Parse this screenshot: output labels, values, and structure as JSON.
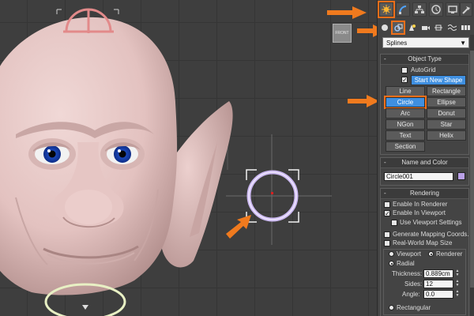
{
  "viewport": {
    "cube_label": "FRONT"
  },
  "panel": {
    "create_tabs": [
      "Create",
      "Modify",
      "Hierarchy",
      "Motion",
      "Display",
      "Utilities"
    ],
    "category_icons": [
      "geometry-icon",
      "shapes-icon",
      "lights-icon",
      "cameras-icon",
      "helpers-icon",
      "space-warps-icon",
      "systems-icon"
    ],
    "dropdown": {
      "value": "Splines"
    },
    "object_type": {
      "header": "Object Type",
      "autogrid": "AutoGrid",
      "start_new_shape": "Start New Shape",
      "buttons": [
        "Line",
        "Rectangle",
        "Circle",
        "Ellipse",
        "Arc",
        "Donut",
        "NGon",
        "Star",
        "Text",
        "Helix",
        "Section"
      ]
    },
    "name_color": {
      "header": "Name and Color",
      "name": "Circle001",
      "color": "#b9a0e6"
    },
    "rendering": {
      "header": "Rendering",
      "enable_renderer": "Enable In Renderer",
      "enable_viewport": "Enable In Viewport",
      "use_viewport_settings": "Use Viewport Settings",
      "generate_mapping": "Generate Mapping Coords.",
      "real_world": "Real-World Map Size",
      "viewport": "Viewport",
      "renderer": "Renderer",
      "radial": "Radial",
      "thickness_label": "Thickness:",
      "thickness": "0.889cm",
      "sides_label": "Sides:",
      "sides": "12",
      "angle_label": "Angle:",
      "angle": "0.0",
      "rectangular": "Rectangular"
    },
    "header_sign": "-"
  },
  "colors": {
    "highlight": "#ef6f1a",
    "selected_button": "#3f8fe0",
    "arrow": "#f07a1e"
  }
}
